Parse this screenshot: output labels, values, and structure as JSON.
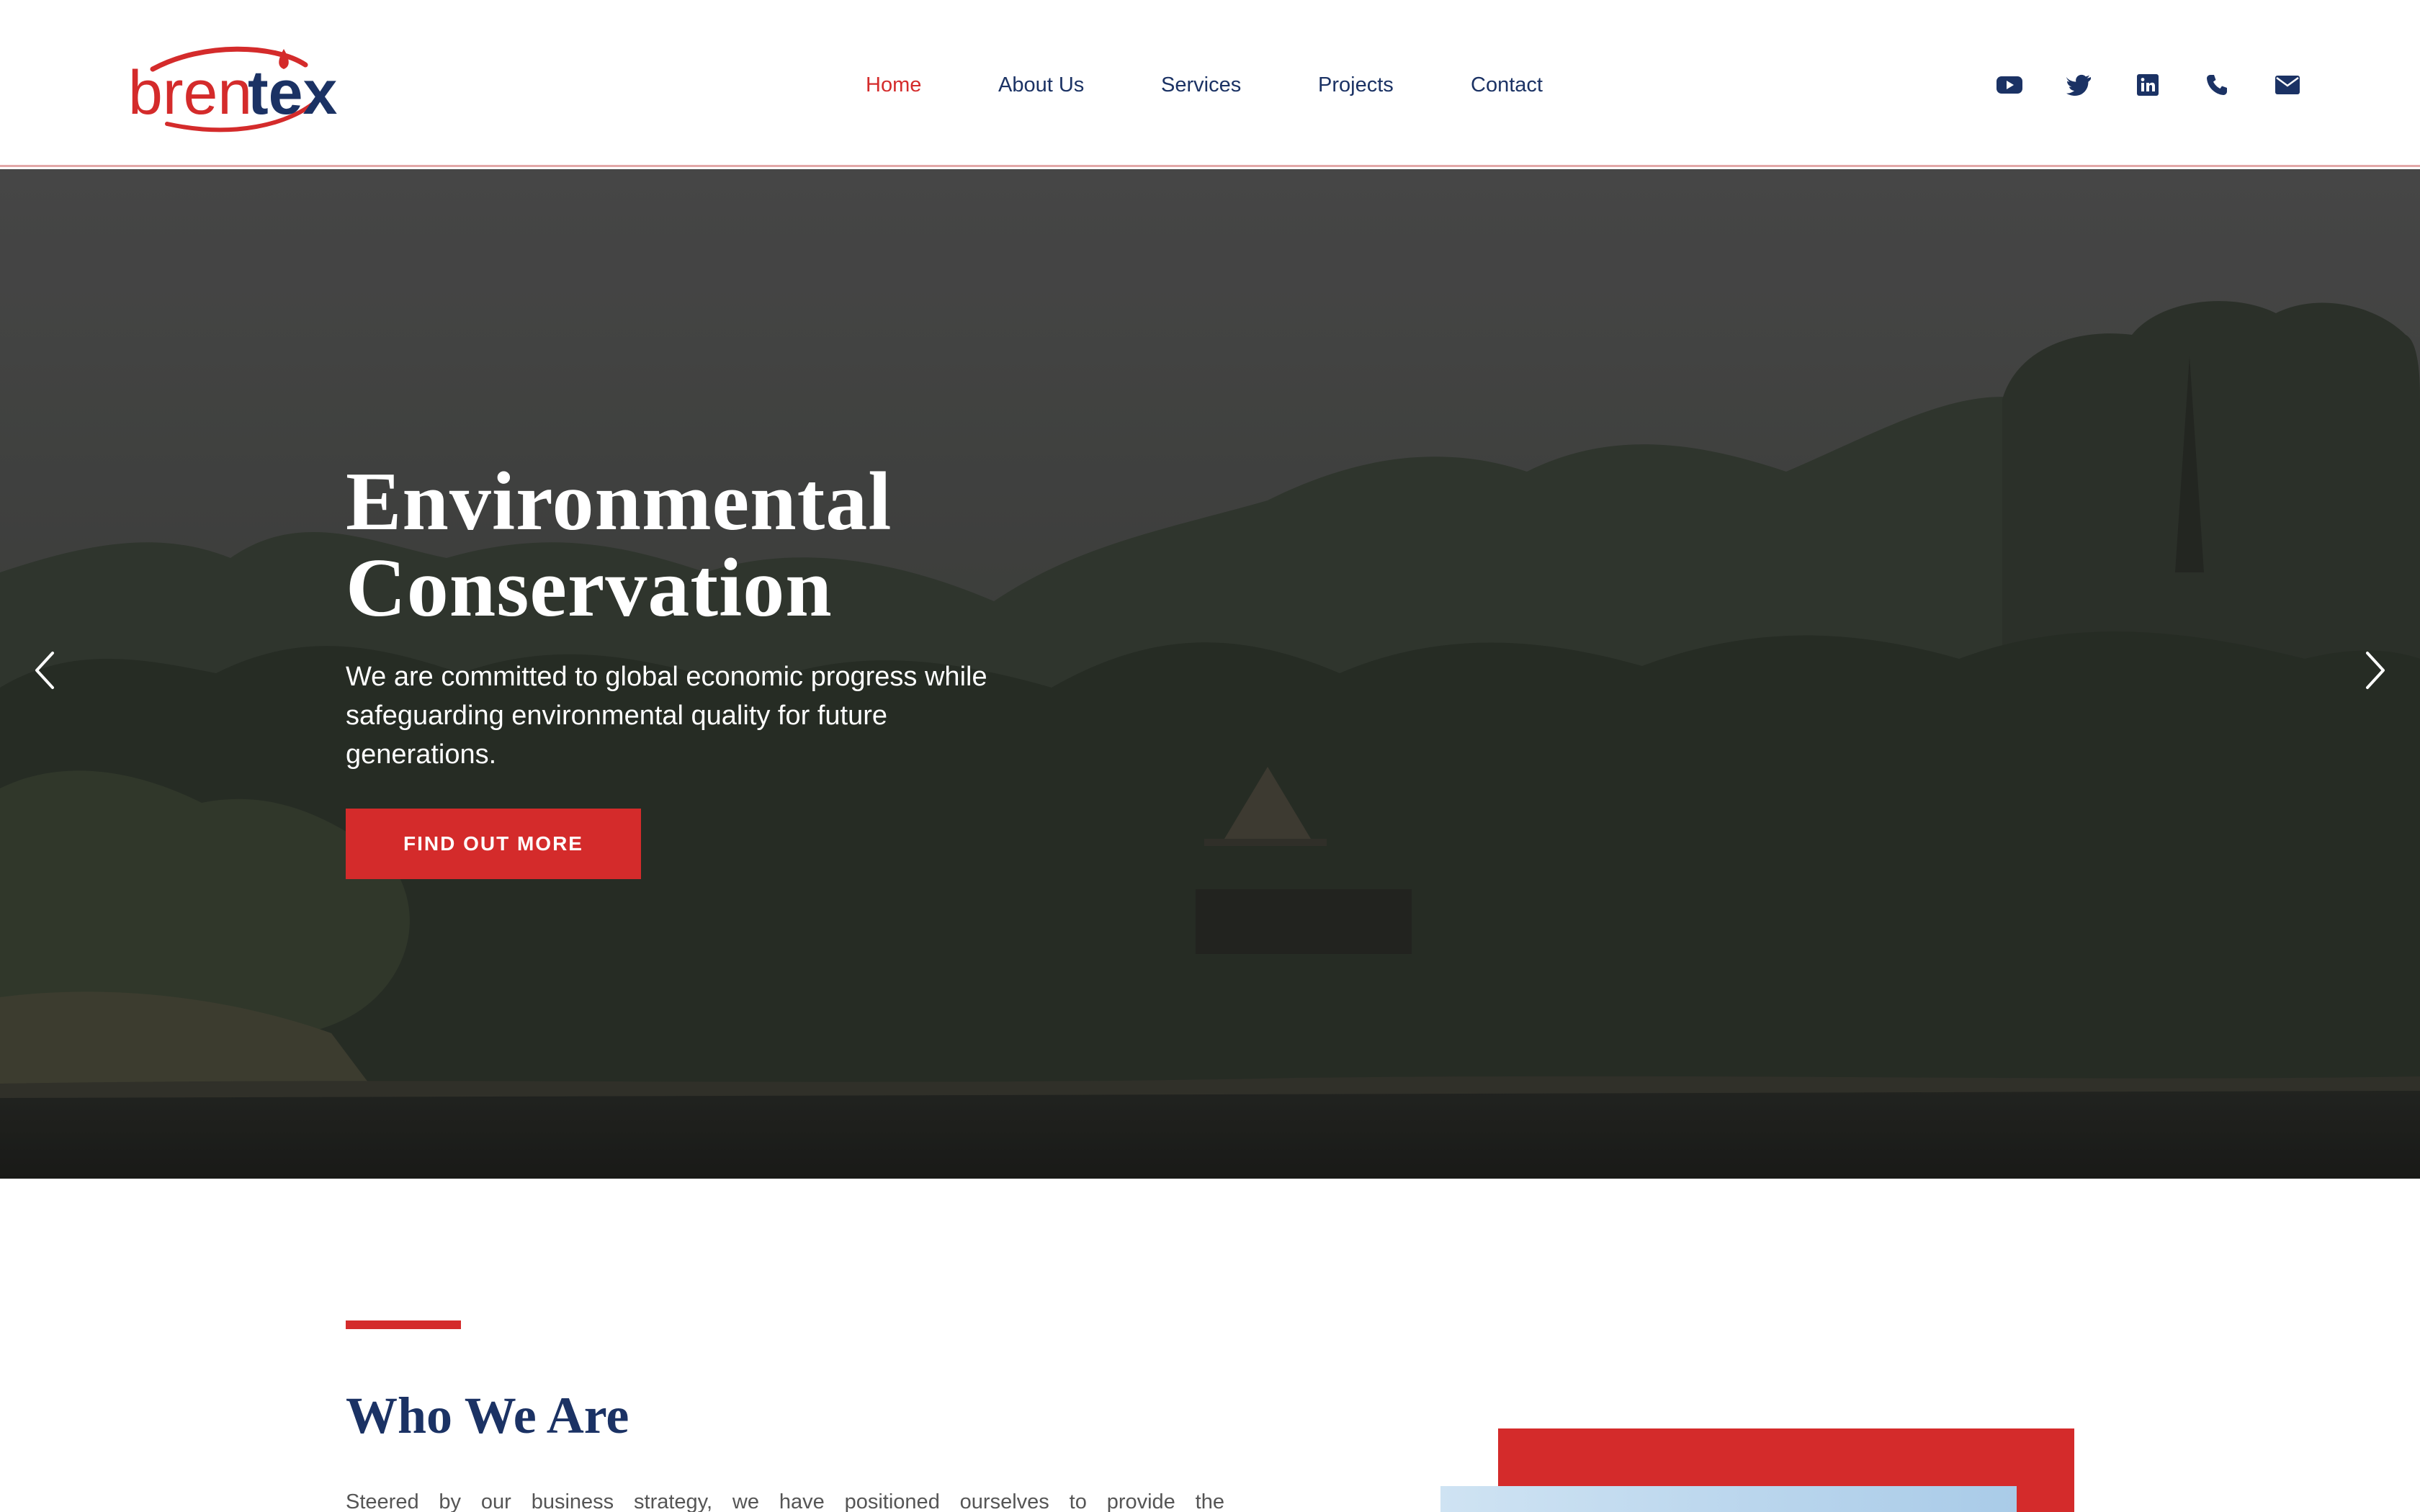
{
  "brand": {
    "logo_text_part1": "bren",
    "logo_text_part2": "tex",
    "colors": {
      "red": "#d42b2b",
      "navy": "#1b3264"
    }
  },
  "nav": {
    "items": [
      {
        "label": "Home",
        "active": true
      },
      {
        "label": "About Us",
        "active": false
      },
      {
        "label": "Services",
        "active": false
      },
      {
        "label": "Projects",
        "active": false
      },
      {
        "label": "Contact",
        "active": false
      }
    ]
  },
  "social": [
    {
      "icon": "youtube-icon"
    },
    {
      "icon": "twitter-icon"
    },
    {
      "icon": "linkedin-icon"
    },
    {
      "icon": "phone-icon"
    },
    {
      "icon": "envelope-icon"
    }
  ],
  "hero": {
    "title_line1": "Environmental",
    "title_line2": "Conservation",
    "subtitle": "We are committed to global economic progress while safeguarding environmental quality for future generations.",
    "button_label": "FIND OUT MORE",
    "prev_icon": "chevron-left-icon",
    "next_icon": "chevron-right-icon"
  },
  "about": {
    "title": "Who We Are",
    "text": "Steered by our business strategy, we have positioned ourselves to provide the"
  }
}
